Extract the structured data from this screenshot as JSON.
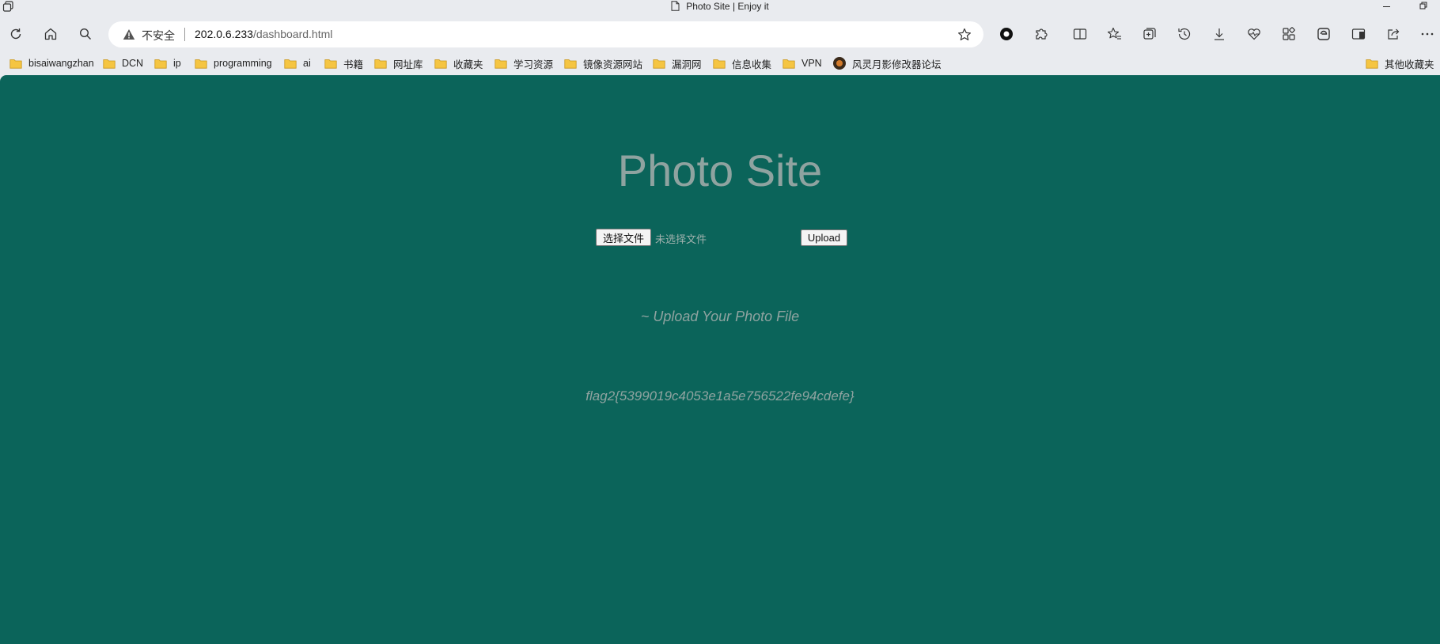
{
  "browser": {
    "tab_title": "Photo Site | Enjoy it",
    "address": {
      "security_label": "不安全",
      "url_host": "202.0.6.233",
      "url_path": "/dashboard.html"
    },
    "bookmarks": [
      {
        "label": "bisaiwangzhan",
        "icon": "folder-icon"
      },
      {
        "label": "DCN",
        "icon": "folder-icon"
      },
      {
        "label": "ip",
        "icon": "folder-icon"
      },
      {
        "label": "programming",
        "icon": "folder-icon"
      },
      {
        "label": "ai",
        "icon": "folder-icon"
      },
      {
        "label": "书籍",
        "icon": "folder-icon"
      },
      {
        "label": "网址库",
        "icon": "folder-icon"
      },
      {
        "label": "收藏夹",
        "icon": "folder-icon"
      },
      {
        "label": "学习资源",
        "icon": "folder-icon"
      },
      {
        "label": "镜像资源网站",
        "icon": "folder-icon"
      },
      {
        "label": "漏洞网",
        "icon": "folder-icon"
      },
      {
        "label": "信息收集",
        "icon": "folder-icon"
      },
      {
        "label": "VPN",
        "icon": "folder-icon"
      },
      {
        "label": "风灵月影修改器论坛",
        "icon": "site-icon"
      }
    ],
    "other_bookmarks": "其他收藏夹"
  },
  "page": {
    "title": "Photo Site",
    "file_input": {
      "button_label": "选择文件",
      "status": "未选择文件"
    },
    "upload_label": "Upload",
    "tagline": "~ Upload Your Photo File",
    "flag": "flag2{5399019c4053e1a5e756522fe94cdefe}"
  },
  "colors": {
    "page_background": "#0b645a",
    "page_text": "#8fa3a0",
    "chrome_background": "#e9ebef"
  }
}
